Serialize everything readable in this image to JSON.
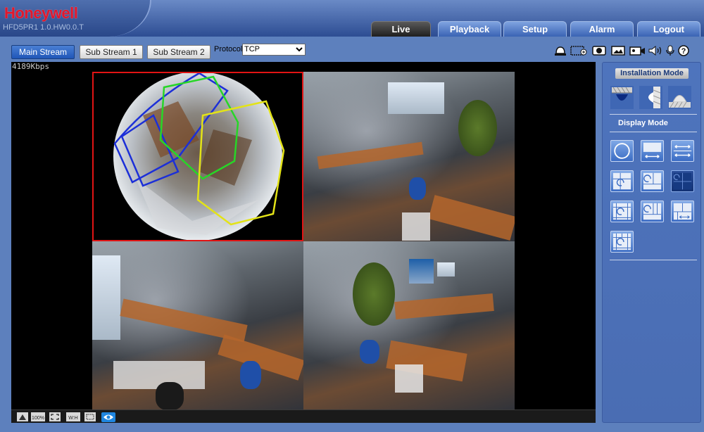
{
  "header": {
    "brand": "Honeywell",
    "model": "HFD5PR1  1.0.HW0.0.T",
    "tabs": [
      {
        "label": "Live",
        "active": true
      },
      {
        "label": "Playback",
        "active": false
      },
      {
        "label": "Setup",
        "active": false
      },
      {
        "label": "Alarm",
        "active": false
      },
      {
        "label": "Logout",
        "active": false
      }
    ]
  },
  "toolbar": {
    "streams": [
      {
        "label": "Main Stream",
        "active": true
      },
      {
        "label": "Sub Stream 1",
        "active": false
      },
      {
        "label": "Sub Stream 2",
        "active": false
      }
    ],
    "protocol_label": "Protocol",
    "protocol_value": "TCP",
    "icons": [
      "alarm-bell-icon",
      "zoom-icon",
      "record-icon",
      "snapshot-icon",
      "video-record-icon",
      "speaker-icon",
      "microphone-icon",
      "help-icon"
    ]
  },
  "video": {
    "bitrate": "4189Kbps",
    "fisheye_region_colors": [
      "#1c2fd8",
      "#27d627",
      "#e3e317"
    ],
    "selected_tile_border": "#e11414"
  },
  "bottom_toolbar": {
    "icons": [
      "clear-icon",
      "ratio-100-icon",
      "fullscreen-icon",
      "wh-ratio-icon",
      "zoom-box-icon",
      "eye-icon"
    ],
    "ratio_label": "100%",
    "wh_label": "W:H"
  },
  "panel": {
    "installation_mode_title": "Installation Mode",
    "display_mode_title": "Display Mode",
    "installation_modes": [
      "ceiling-mount-icon",
      "wall-mount-icon",
      "ground-mount-icon"
    ],
    "display_modes": [
      "mode-fisheye-icon",
      "mode-panorama-icon",
      "mode-dual-panorama-icon",
      "mode-1p1-icon",
      "mode-2p-icon",
      "mode-1p3-selected-icon",
      "mode-1p4-icon",
      "mode-1p6-icon",
      "mode-4p-icon",
      "mode-1p8-icon"
    ],
    "selected_display_mode": 5
  },
  "colors": {
    "accent": "#1f56b8",
    "brand_red": "#e0182d",
    "panel_blue": "#4e74bd"
  }
}
